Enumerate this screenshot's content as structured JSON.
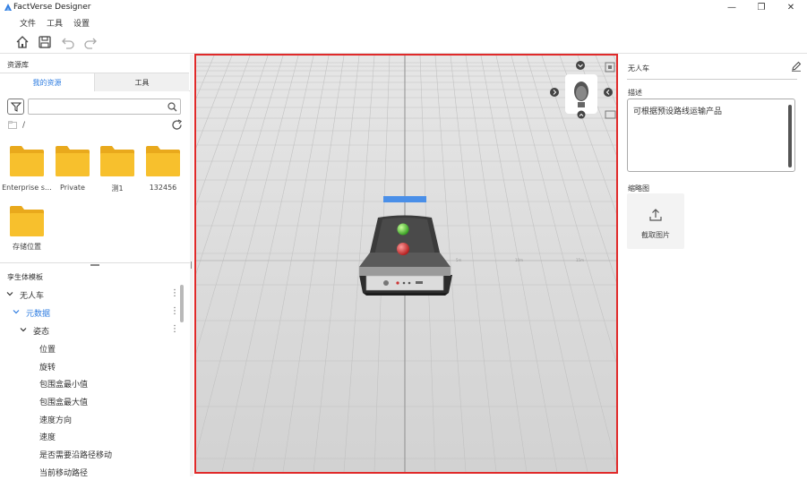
{
  "app": {
    "title": "FactVerse Designer"
  },
  "window_controls": {
    "minimize": "—",
    "maximize": "❐",
    "close": "✕"
  },
  "menu": [
    "文件",
    "工具",
    "设置"
  ],
  "toolbar": {
    "icons": [
      "home-icon",
      "save-icon",
      "undo-icon",
      "redo-icon"
    ]
  },
  "resources": {
    "title": "资源库",
    "tabs": [
      "我的资源",
      "工具"
    ],
    "search": {
      "value": "",
      "placeholder": ""
    },
    "breadcrumb": "/",
    "folders": [
      "Enterprise s…",
      "Private",
      "测1",
      "132456",
      "存储位置"
    ]
  },
  "twin_templates": {
    "title": "孪生体模板",
    "rows": [
      {
        "label": "无人车",
        "expanded": true
      },
      {
        "label": "元数据",
        "expanded": true,
        "highlight": true
      },
      {
        "label": "姿态",
        "expanded": true
      },
      {
        "label": "位置"
      },
      {
        "label": "旋转"
      },
      {
        "label": "包围盒最小值"
      },
      {
        "label": "包围盒最大值"
      },
      {
        "label": "速度方向"
      },
      {
        "label": "速度"
      },
      {
        "label": "是否需要沿路径移动"
      },
      {
        "label": "当前移动路径"
      }
    ]
  },
  "properties": {
    "name": "无人车",
    "description_label": "描述",
    "description": "可根据预设路线运输产品",
    "thumbnail_label": "缩略图",
    "capture_label": "截取图片"
  },
  "colors": {
    "accent": "#2f7de1",
    "viewport_border": "#e02a2a",
    "folder": "#f7c02d"
  }
}
